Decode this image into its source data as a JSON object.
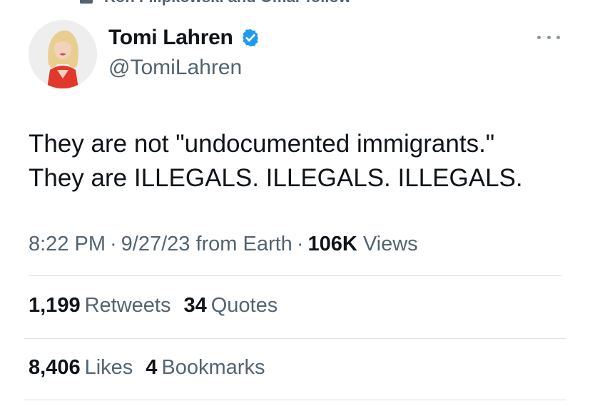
{
  "social_context": {
    "text": "Ron Filipkowski and Omar follow",
    "icon": "person-icon"
  },
  "author": {
    "name": "Tomi Lahren",
    "handle": "@TomiLahren",
    "verified_icon": "verified-badge-icon",
    "verified_color": "#1d9bf0"
  },
  "more_icon": "more-options-icon",
  "tweet": {
    "line1": "They are not \"undocumented immigrants.\"",
    "line2": "They are ILLEGALS. ILLEGALS. ILLEGALS."
  },
  "meta": {
    "time": "8:22 PM",
    "separator": "·",
    "date": "9/27/23",
    "source": "from Earth",
    "views_count": "106K",
    "views_label": "Views"
  },
  "stats": {
    "retweets_count": "1,199",
    "retweets_label": "Retweets",
    "quotes_count": "34",
    "quotes_label": "Quotes",
    "likes_count": "8,406",
    "likes_label": "Likes",
    "bookmarks_count": "4",
    "bookmarks_label": "Bookmarks"
  },
  "colors": {
    "text_primary": "#0f1419",
    "text_secondary": "#536471",
    "divider": "#dcdfe3"
  }
}
